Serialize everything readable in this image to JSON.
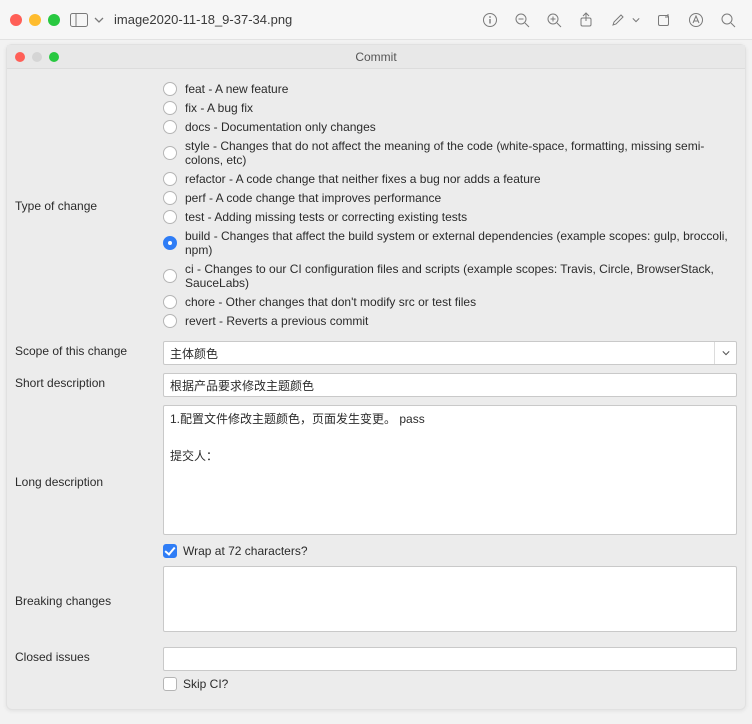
{
  "outer": {
    "filename": "image2020-11-18_9-37-34.png"
  },
  "dialog": {
    "title": "Commit",
    "labels": {
      "type": "Type of change",
      "scope": "Scope of this change",
      "short": "Short description",
      "long": "Long description",
      "breaking": "Breaking changes",
      "closed": "Closed issues"
    },
    "types": [
      {
        "text": "feat - A new feature",
        "checked": false
      },
      {
        "text": "fix - A bug fix",
        "checked": false
      },
      {
        "text": "docs - Documentation only changes",
        "checked": false
      },
      {
        "text": "style - Changes that do not affect the meaning of the code (white-space, formatting, missing semi-colons, etc)",
        "checked": false
      },
      {
        "text": "refactor - A code change that neither fixes a bug nor adds a feature",
        "checked": false
      },
      {
        "text": "perf - A code change that improves performance",
        "checked": false
      },
      {
        "text": "test - Adding missing tests or correcting existing tests",
        "checked": false
      },
      {
        "text": "build - Changes that affect the build system or external dependencies (example scopes: gulp, broccoli, npm)",
        "checked": true
      },
      {
        "text": "ci - Changes to our CI configuration files and scripts (example scopes: Travis, Circle, BrowserStack, SauceLabs)",
        "checked": false
      },
      {
        "text": "chore - Other changes that don't modify src or test files",
        "checked": false
      },
      {
        "text": "revert - Reverts a previous commit",
        "checked": false
      }
    ],
    "scope_value": "主体颜色",
    "short_value": "根据产品要求修改主题颜色",
    "long_value": "1.配置文件修改主题颜色，页面发生变更。 pass\n\n提交人：",
    "wrap72": {
      "label": "Wrap at 72 characters?",
      "checked": true
    },
    "breaking_value": "",
    "closed_value": "",
    "skipci": {
      "label": "Skip CI?",
      "checked": false
    }
  }
}
